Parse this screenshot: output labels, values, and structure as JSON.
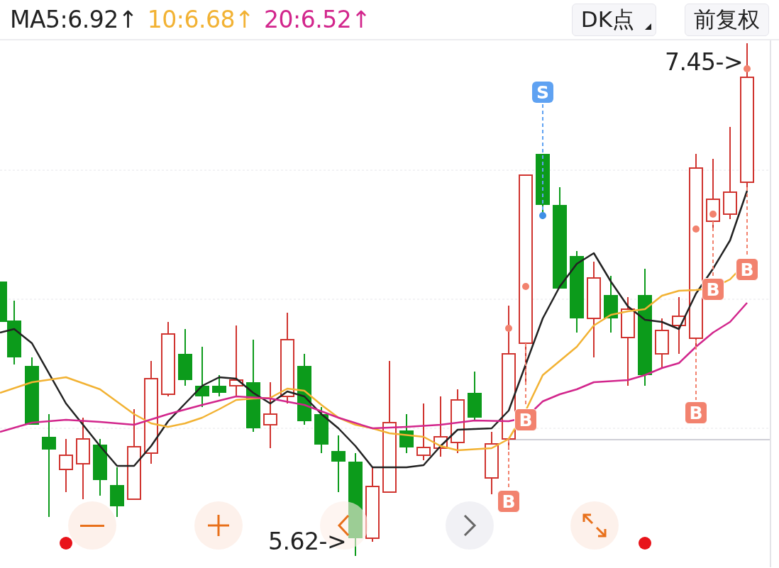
{
  "legend": [
    {
      "label": "MA5:6.92↑",
      "color": "#222222"
    },
    {
      "label": "10:6.68↑",
      "color": "#f2b233"
    },
    {
      "label": "20:6.52↑",
      "color": "#d2268c"
    }
  ],
  "buttons": [
    {
      "label": "DK点",
      "kind": "dropdown"
    },
    {
      "label": "前复权",
      "kind": "plain"
    }
  ],
  "chart": {
    "high_label": "7.45->",
    "low_label": "5.62->",
    "signals": [
      {
        "label": "S",
        "kind": "sell"
      },
      {
        "label": "B",
        "kind": "buy"
      },
      {
        "label": "B",
        "kind": "buy"
      },
      {
        "label": "B",
        "kind": "buy"
      },
      {
        "label": "B",
        "kind": "buy"
      },
      {
        "label": "B",
        "kind": "buy"
      }
    ]
  }
}
